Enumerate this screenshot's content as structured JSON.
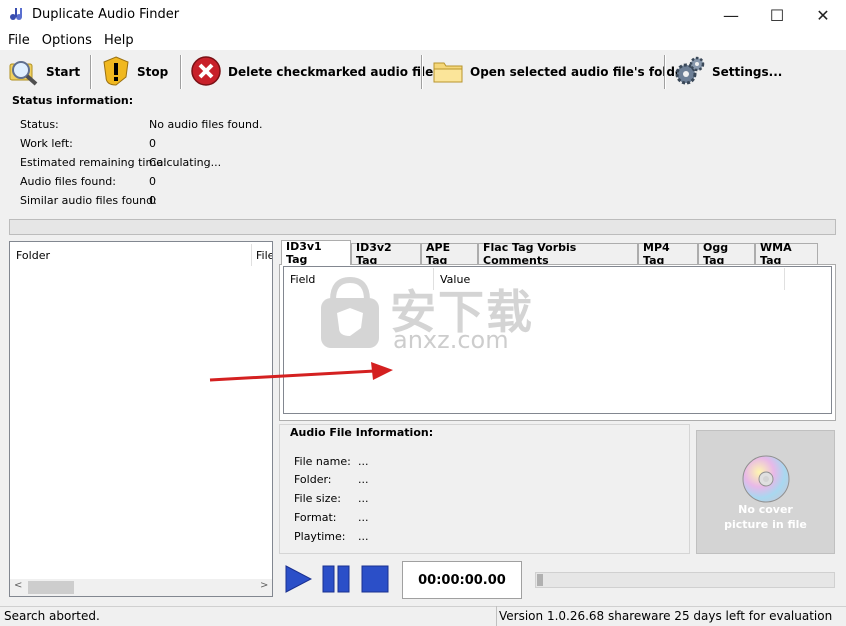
{
  "window": {
    "title": "Duplicate Audio Finder",
    "minimize": "—",
    "maximize": "☐",
    "close": "✕"
  },
  "menu": [
    "File",
    "Options",
    "Help"
  ],
  "toolbar": {
    "start": "Start",
    "stop": "Stop",
    "delete": "Delete checkmarked audio files...",
    "open_folder": "Open selected audio file's folder",
    "settings": "Settings..."
  },
  "status": {
    "heading": "Status information:",
    "rows": [
      {
        "label": "Status:",
        "value": "No audio files found."
      },
      {
        "label": "Work left:",
        "value": "0"
      },
      {
        "label": "Estimated remaining time:",
        "value": "Calculating..."
      },
      {
        "label": "Audio files found:",
        "value": "0"
      },
      {
        "label": "Similar audio files found:",
        "value": "0"
      }
    ]
  },
  "progress": 0,
  "list": {
    "col_folder": "Folder",
    "col_file": "File"
  },
  "tabs": [
    "ID3v1 Tag",
    "ID3v2 Tag",
    "APE Tag",
    "Flac Tag Vorbis Comments",
    "MP4 Tag",
    "Ogg Tag",
    "WMA Tag"
  ],
  "tag_table": {
    "col_field": "Field",
    "col_value": "Value"
  },
  "audio_info": {
    "heading": "Audio File Information:",
    "rows": [
      {
        "label": "File name:",
        "value": "..."
      },
      {
        "label": "Folder:",
        "value": "..."
      },
      {
        "label": "File size:",
        "value": "..."
      },
      {
        "label": "Format:",
        "value": "..."
      },
      {
        "label": "Playtime:",
        "value": "..."
      }
    ]
  },
  "cover": {
    "text_line1": "No cover",
    "text_line2": "picture in file"
  },
  "player": {
    "time": "00:00:00.00"
  },
  "statusbar": {
    "left": "Search aborted.",
    "right": "Version 1.0.26.68 shareware 25 days left for evaluation"
  },
  "watermark": {
    "line1": "安下载",
    "line2": "anxz.com"
  },
  "colors": {
    "play_blue": "#2b4fc8",
    "arrow_red": "#d42020",
    "delete_red": "#c8202a"
  }
}
